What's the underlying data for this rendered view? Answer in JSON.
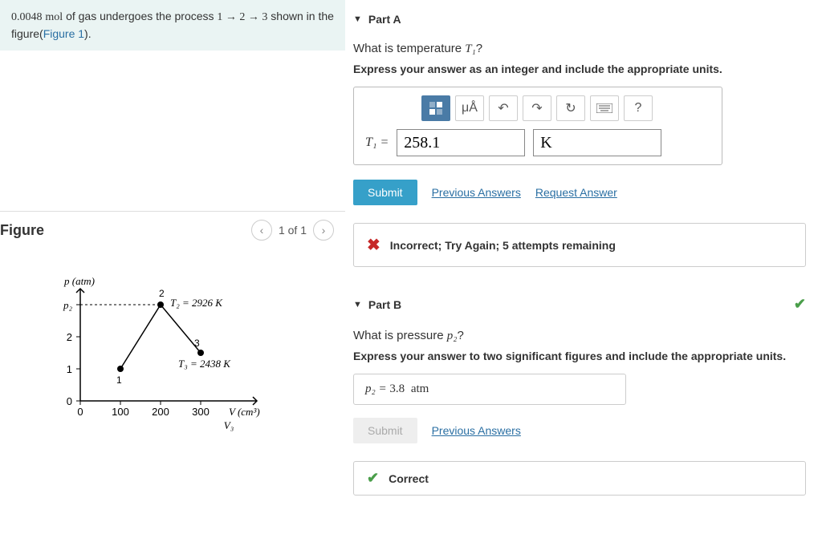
{
  "problem": {
    "mol_value": "0.0048",
    "mol_unit": "mol",
    "text_1": " of gas undergoes the process ",
    "process": "1 → 2 → 3",
    "text_2": " shown in the figure(",
    "figure_link": "Figure 1",
    "text_3": ")."
  },
  "figure": {
    "title": "Figure",
    "nav_label": "1 of 1"
  },
  "chart_data": {
    "type": "scatter",
    "title": "",
    "xlabel": "V (cm³)",
    "ylabel": "p (atm)",
    "x_ticks": [
      "0",
      "100",
      "200",
      "300"
    ],
    "y_ticks": [
      "0",
      "1",
      "2",
      "p₂"
    ],
    "y_tick_values": [
      0,
      1,
      2,
      3
    ],
    "points": [
      {
        "label": "1",
        "x": 100,
        "y": 1,
        "annotation": ""
      },
      {
        "label": "2",
        "x": 200,
        "y": 3,
        "annotation": "T₂ = 2926 K"
      },
      {
        "label": "3",
        "x": 300,
        "y": 1.5,
        "annotation": "T₃ = 2438 K"
      }
    ],
    "x_extra_tick": "V₃",
    "segments": [
      [
        0,
        1
      ],
      [
        1,
        2
      ]
    ],
    "xlim": [
      0,
      360
    ],
    "ylim": [
      0,
      3.2
    ]
  },
  "partA": {
    "header": "Part A",
    "question_pre": "What is temperature ",
    "question_var": "T₁",
    "question_post": "?",
    "instruction": "Express your answer as an integer and include the appropriate units.",
    "toolbar": {
      "ua": "μÅ",
      "help": "?"
    },
    "var_label": "T₁ = ",
    "value": "258.1",
    "unit": "K",
    "submit": "Submit",
    "prev": "Previous Answers",
    "request": "Request Answer",
    "feedback": "Incorrect; Try Again; 5 attempts remaining"
  },
  "partB": {
    "header": "Part B",
    "question_pre": "What is pressure ",
    "question_var": "p₂",
    "question_post": "?",
    "instruction": "Express your answer to two significant figures and include the appropriate units.",
    "var_label": "p₂ = ",
    "value": "3.8",
    "unit": "atm",
    "submit": "Submit",
    "prev": "Previous Answers",
    "feedback": "Correct"
  }
}
